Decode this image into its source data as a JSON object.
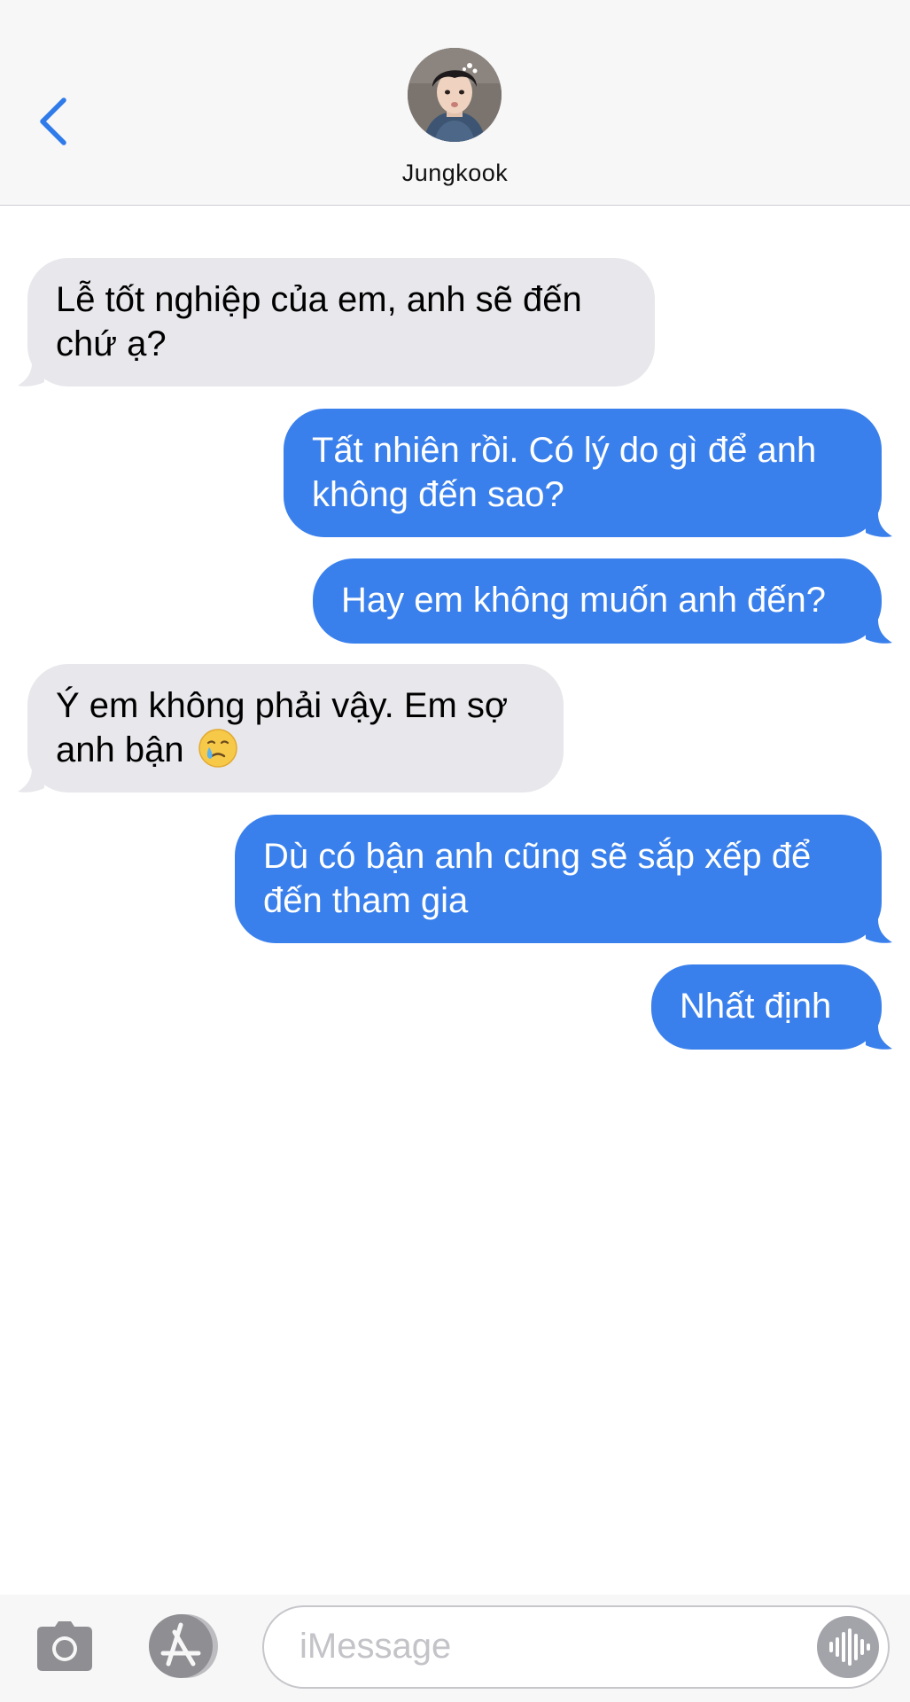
{
  "header": {
    "contact_name": "Jungkook"
  },
  "messages": [
    {
      "direction": "incoming",
      "text": "Lễ tốt nghiệp của em, anh sẽ đến chứ ạ?"
    },
    {
      "direction": "outgoing",
      "text": "Tất nhiên rồi. Có lý do gì để anh không đến sao?"
    },
    {
      "direction": "outgoing",
      "text": "Hay em không muốn anh đến?"
    },
    {
      "direction": "incoming",
      "text": "Ý em không phải vậy. Em sợ anh bận",
      "emoji": "crying-face-emoji"
    },
    {
      "direction": "outgoing",
      "text": "Dù có bận anh cũng sẽ sắp xếp để đến tham gia"
    },
    {
      "direction": "outgoing",
      "text": "Nhất định"
    }
  ],
  "composer": {
    "placeholder": "iMessage"
  },
  "colors": {
    "incoming_bubble": "#e7e7ec",
    "outgoing_bubble": "#3a80ec",
    "accent": "#2f7bea"
  }
}
